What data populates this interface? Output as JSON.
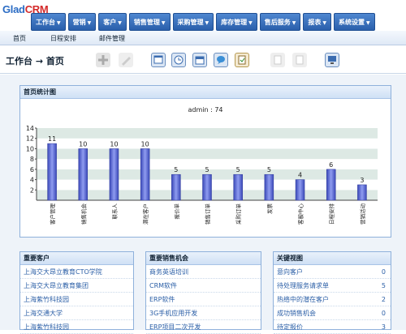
{
  "app": {
    "logo_main": "Glad",
    "logo_crm": "CRM"
  },
  "nav": [
    {
      "label": "工作台"
    },
    {
      "label": "营销"
    },
    {
      "label": "客户"
    },
    {
      "label": "销售管理"
    },
    {
      "label": "采购管理"
    },
    {
      "label": "库存管理"
    },
    {
      "label": "售后服务"
    },
    {
      "label": "报表"
    },
    {
      "label": "系统设置"
    }
  ],
  "subnav": [
    {
      "label": "首页"
    },
    {
      "label": "日程安排"
    },
    {
      "label": "邮件管理"
    }
  ],
  "breadcrumb": {
    "root": "工作台",
    "separator": "→",
    "current": "首页"
  },
  "toolbar_icons": [
    "add-icon",
    "edit-icon",
    "window-icon",
    "clock-icon",
    "calendar-icon",
    "chat-icon",
    "note-icon",
    "copy-icon",
    "paste-icon",
    "monitor-icon"
  ],
  "stats_panel": {
    "title": "首页统计图"
  },
  "chart_data": {
    "type": "bar",
    "title": "admin : 74",
    "categories": [
      "客户管理",
      "销售机会",
      "联系人",
      "潜在客户",
      "报价单",
      "销售订单",
      "采购订单",
      "发票",
      "客服中心",
      "日程安排",
      "营销活动"
    ],
    "values": [
      11,
      10,
      10,
      10,
      5,
      5,
      5,
      5,
      4,
      6,
      3
    ],
    "ylim": [
      0,
      14
    ],
    "yticks": [
      2,
      4,
      6,
      8,
      10,
      12,
      14
    ],
    "grid": true,
    "bar_color": "#5b6fd6"
  },
  "customers": {
    "title": "重要客户",
    "items": [
      "上海交大昂立教育CTO学院",
      "上海交大昂立教育集团",
      "上海紫竹科技园",
      "上海交通大学",
      "上海紫竹科技园"
    ]
  },
  "opportunities": {
    "title": "重要销售机会",
    "items": [
      "商务英语培训",
      "CRM软件",
      "ERP软件",
      "3G手机应用开发",
      "ERP项目二次开发"
    ]
  },
  "views": {
    "title": "关键视图",
    "items": [
      {
        "label": "意向客户",
        "count": "0"
      },
      {
        "label": "待处理服务请求单",
        "count": "5"
      },
      {
        "label": "热络中的潜在客户",
        "count": "2"
      },
      {
        "label": "成功销售机会",
        "count": "0"
      },
      {
        "label": "待定报价",
        "count": "3"
      }
    ]
  }
}
